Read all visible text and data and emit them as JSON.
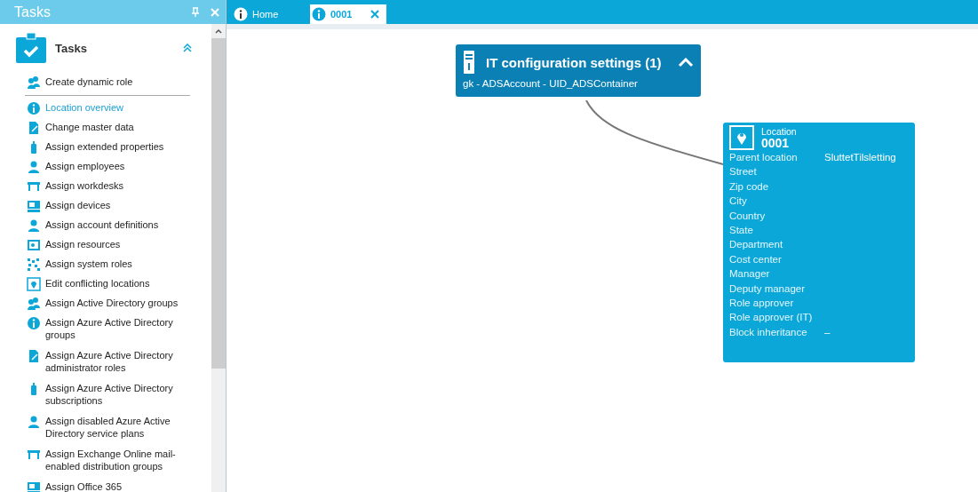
{
  "sidebar": {
    "title": "Tasks",
    "section": {
      "title": "Tasks",
      "expanded": true,
      "top_items": [
        {
          "label": "Create dynamic role",
          "selected": false
        }
      ],
      "items": [
        {
          "label": "Location overview",
          "selected": true
        },
        {
          "label": "Change master data",
          "selected": false
        },
        {
          "label": "Assign extended properties",
          "selected": false
        },
        {
          "label": "Assign employees",
          "selected": false
        },
        {
          "label": "Assign workdesks",
          "selected": false
        },
        {
          "label": "Assign devices",
          "selected": false
        },
        {
          "label": "Assign account definitions",
          "selected": false
        },
        {
          "label": "Assign resources",
          "selected": false
        },
        {
          "label": "Assign system roles",
          "selected": false
        },
        {
          "label": "Edit conflicting locations",
          "selected": false
        },
        {
          "label": "Assign Active Directory groups",
          "selected": false
        },
        {
          "label": "Assign Azure Active Directory groups",
          "selected": false
        },
        {
          "label": "Assign Azure Active Directory administrator roles",
          "selected": false
        },
        {
          "label": "Assign Azure Active Directory subscriptions",
          "selected": false
        },
        {
          "label": "Assign disabled Azure Active Directory service plans",
          "selected": false
        },
        {
          "label": "Assign Exchange Online mail-enabled distribution groups",
          "selected": false
        },
        {
          "label": "Assign Office 365",
          "selected": false
        }
      ]
    }
  },
  "tabs": [
    {
      "label": "Home",
      "selected": false
    },
    {
      "label": "0001",
      "selected": true
    }
  ],
  "canvas": {
    "group_node": {
      "title": "IT configuration settings (1)",
      "subtitle": "gk - ADSAccount - UID_ADSContainer",
      "expanded": true
    },
    "location_node": {
      "type": "Location",
      "name": "0001",
      "properties": [
        {
          "label": "Parent location",
          "value": "SluttetTilsletting"
        },
        {
          "label": "Street"
        },
        {
          "label": "Zip code"
        },
        {
          "label": "City"
        },
        {
          "label": "Country"
        },
        {
          "label": "State"
        },
        {
          "label": "Department"
        },
        {
          "label": "Cost center"
        },
        {
          "label": "Manager"
        },
        {
          "label": "Deputy manager"
        },
        {
          "label": "Role approver"
        },
        {
          "label": "Role approver (IT)"
        },
        {
          "label": "Block inheritance",
          "value": "–"
        }
      ]
    }
  }
}
